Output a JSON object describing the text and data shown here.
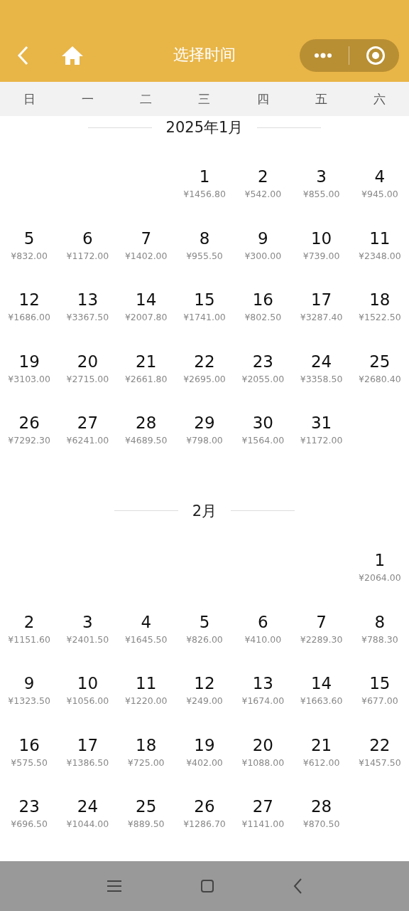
{
  "header": {
    "title": "选择时间"
  },
  "weekdays": [
    "日",
    "一",
    "二",
    "三",
    "四",
    "五",
    "六"
  ],
  "months": [
    {
      "title": "2025年1月",
      "weeks": [
        {
          "kind": "leading",
          "days": [
            {
              "day": "1",
              "price": "¥1456.80"
            },
            {
              "day": "2",
              "price": "¥542.00"
            },
            {
              "day": "3",
              "price": "¥855.00"
            },
            {
              "day": "4",
              "price": "¥945.00"
            }
          ]
        },
        {
          "kind": "full",
          "days": [
            {
              "day": "5",
              "price": "¥832.00"
            },
            {
              "day": "6",
              "price": "¥1172.00"
            },
            {
              "day": "7",
              "price": "¥1402.00"
            },
            {
              "day": "8",
              "price": "¥955.50"
            },
            {
              "day": "9",
              "price": "¥300.00"
            },
            {
              "day": "10",
              "price": "¥739.00"
            },
            {
              "day": "11",
              "price": "¥2348.00"
            }
          ]
        },
        {
          "kind": "full",
          "days": [
            {
              "day": "12",
              "price": "¥1686.00"
            },
            {
              "day": "13",
              "price": "¥3367.50"
            },
            {
              "day": "14",
              "price": "¥2007.80"
            },
            {
              "day": "15",
              "price": "¥1741.00"
            },
            {
              "day": "16",
              "price": "¥802.50"
            },
            {
              "day": "17",
              "price": "¥3287.40"
            },
            {
              "day": "18",
              "price": "¥1522.50"
            }
          ]
        },
        {
          "kind": "full",
          "days": [
            {
              "day": "19",
              "price": "¥3103.00"
            },
            {
              "day": "20",
              "price": "¥2715.00"
            },
            {
              "day": "21",
              "price": "¥2661.80"
            },
            {
              "day": "22",
              "price": "¥2695.00"
            },
            {
              "day": "23",
              "price": "¥2055.00"
            },
            {
              "day": "24",
              "price": "¥3358.50"
            },
            {
              "day": "25",
              "price": "¥2680.40"
            }
          ]
        },
        {
          "kind": "trailing",
          "days": [
            {
              "day": "26",
              "price": "¥7292.30"
            },
            {
              "day": "27",
              "price": "¥6241.00"
            },
            {
              "day": "28",
              "price": "¥4689.50"
            },
            {
              "day": "29",
              "price": "¥798.00"
            },
            {
              "day": "30",
              "price": "¥1564.00"
            },
            {
              "day": "31",
              "price": "¥1172.00"
            }
          ]
        }
      ]
    },
    {
      "title": "2月",
      "weeks": [
        {
          "kind": "leading",
          "days": [
            {
              "day": "1",
              "price": "¥2064.00"
            }
          ]
        },
        {
          "kind": "full",
          "days": [
            {
              "day": "2",
              "price": "¥1151.60"
            },
            {
              "day": "3",
              "price": "¥2401.50"
            },
            {
              "day": "4",
              "price": "¥1645.50"
            },
            {
              "day": "5",
              "price": "¥826.00"
            },
            {
              "day": "6",
              "price": "¥410.00"
            },
            {
              "day": "7",
              "price": "¥2289.30"
            },
            {
              "day": "8",
              "price": "¥788.30"
            }
          ]
        },
        {
          "kind": "full",
          "days": [
            {
              "day": "9",
              "price": "¥1323.50"
            },
            {
              "day": "10",
              "price": "¥1056.00"
            },
            {
              "day": "11",
              "price": "¥1220.00"
            },
            {
              "day": "12",
              "price": "¥249.00"
            },
            {
              "day": "13",
              "price": "¥1674.00"
            },
            {
              "day": "14",
              "price": "¥1663.60"
            },
            {
              "day": "15",
              "price": "¥677.00"
            }
          ]
        },
        {
          "kind": "full",
          "days": [
            {
              "day": "16",
              "price": "¥575.50"
            },
            {
              "day": "17",
              "price": "¥1386.50"
            },
            {
              "day": "18",
              "price": "¥725.00"
            },
            {
              "day": "19",
              "price": "¥402.00"
            },
            {
              "day": "20",
              "price": "¥1088.00"
            },
            {
              "day": "21",
              "price": "¥612.00"
            },
            {
              "day": "22",
              "price": "¥1457.50"
            }
          ]
        },
        {
          "kind": "trailing",
          "days": [
            {
              "day": "23",
              "price": "¥696.50"
            },
            {
              "day": "24",
              "price": "¥1044.00"
            },
            {
              "day": "25",
              "price": "¥889.50"
            },
            {
              "day": "26",
              "price": "¥1286.70"
            },
            {
              "day": "27",
              "price": "¥1141.00"
            },
            {
              "day": "28",
              "price": "¥870.50"
            }
          ]
        }
      ]
    }
  ]
}
